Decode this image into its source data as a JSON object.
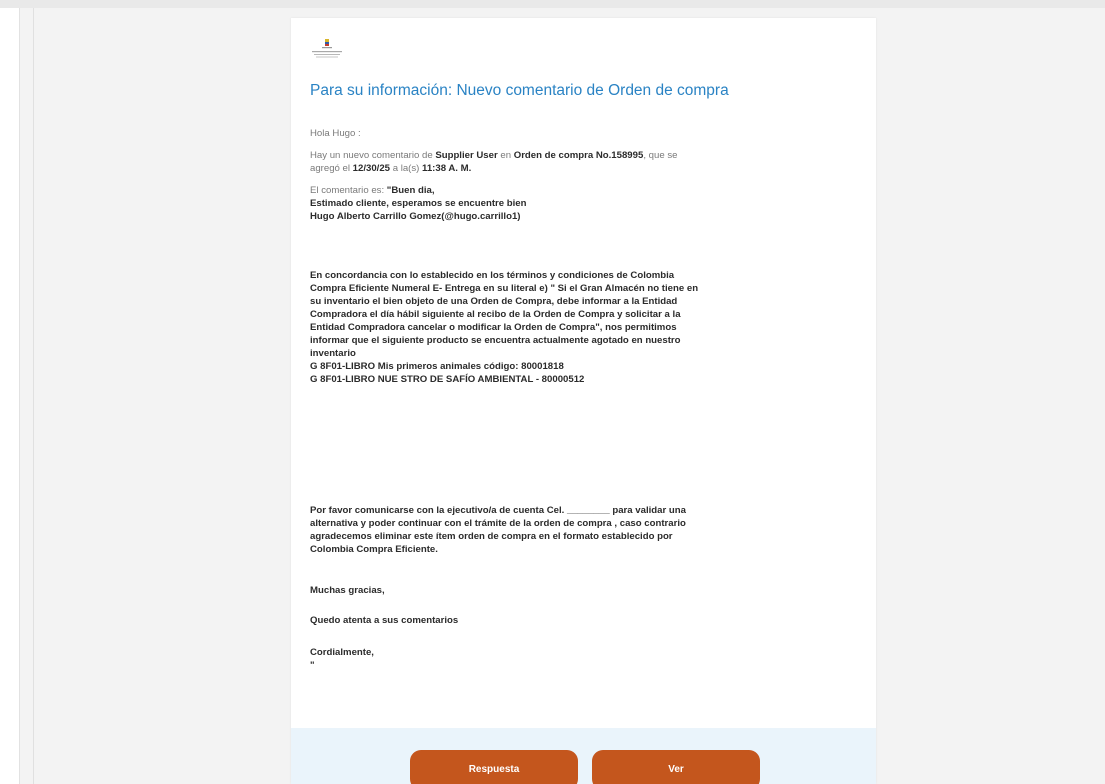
{
  "email": {
    "title": "Para su información: Nuevo comentario de Orden de compra",
    "greeting": "Hola Hugo :",
    "notice": {
      "p1": "Hay un nuevo comentario de ",
      "author": "Supplier User",
      "p2": " en ",
      "order": "Orden de compra No.158995",
      "p3": ", que se",
      "p4": "agregó el ",
      "date": "12/30/25",
      "p5": " a la(s) ",
      "time": "11:38 A. M."
    },
    "comment_label": "El comentario es: ",
    "comment_lines": [
      "\"Buen dia,",
      "Estimado cliente, esperamos se encuentre bien",
      "Hugo Alberto Carrillo Gomez(@hugo.carrillo1)",
      "En concordancia con lo establecido en los términos y condiciones de Colombia",
      "Compra Eficiente Numeral E- Entrega en su literal e) \" Si el Gran Almacén no tiene en",
      "su inventario el bien objeto de una Orden de Compra, debe informar a la Entidad",
      "Compradora el día hábil siguiente al recibo de la Orden de Compra y solicitar a la",
      "Entidad Compradora cancelar o modificar la Orden de Compra\", nos permitimos",
      "informar que el siguiente producto se encuentra actualmente agotado en nuestro",
      "inventario",
      "G 8F01-LIBRO Mis primeros animales código: 80001818",
      "G 8F01-LIBRO NUE STRO DE SAFÍO AMBIENTAL - 80000512",
      "Por favor comunicarse con la ejecutivo/a de cuenta Cel. ________ para validar una",
      "alternativa y poder continuar con el trámite de la orden de compra , caso contrario",
      "agradecemos eliminar este ítem orden de compra en el formato establecido por",
      "Colombia Compra Eficiente.",
      "Muchas gracias,",
      "Quedo atenta a sus comentarios",
      "Cordialmente,",
      "\""
    ],
    "buttons": {
      "reply_label": "Respuesta",
      "view_label": "Ver"
    },
    "colors": {
      "title": "#2a83c4",
      "button": "#c4561d",
      "footer": "#eaf4fb"
    }
  }
}
